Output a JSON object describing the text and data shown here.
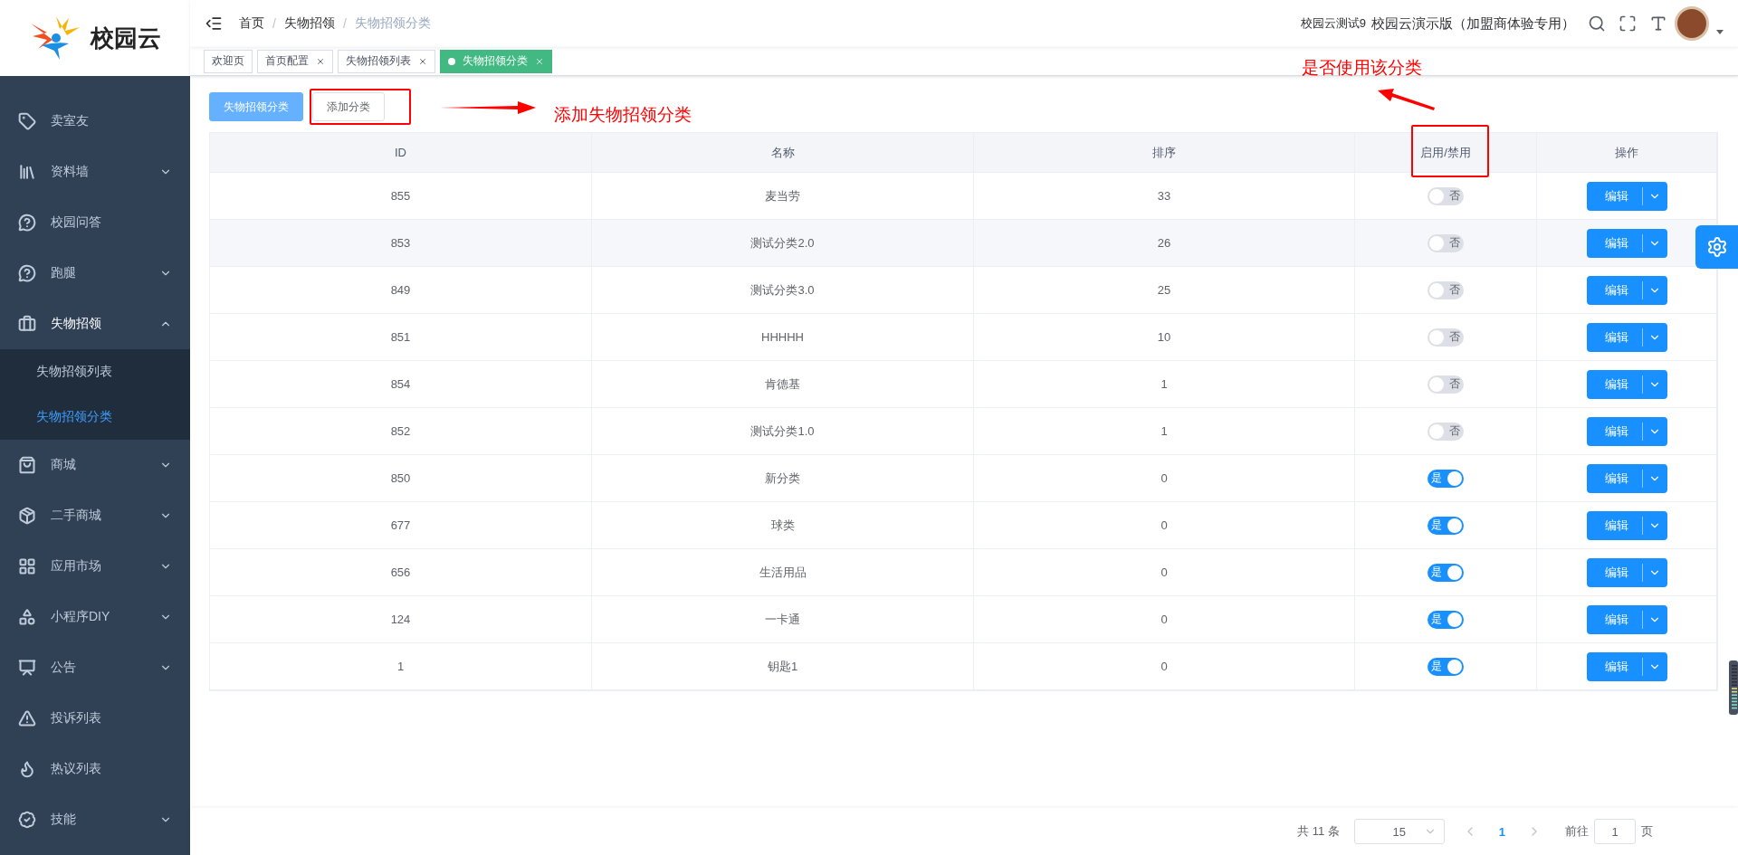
{
  "logo": {
    "text": "校园云"
  },
  "sidebar": {
    "items": [
      {
        "label": "卖室友",
        "expandable": false,
        "expanded": false
      },
      {
        "label": "资料墙",
        "expandable": true,
        "expanded": false
      },
      {
        "label": "校园问答",
        "expandable": false,
        "expanded": false
      },
      {
        "label": "跑腿",
        "expandable": true,
        "expanded": false
      },
      {
        "label": "失物招领",
        "expandable": true,
        "expanded": true,
        "children": [
          {
            "label": "失物招领列表",
            "selected": false
          },
          {
            "label": "失物招领分类",
            "selected": true
          }
        ]
      },
      {
        "label": "商城",
        "expandable": true,
        "expanded": false
      },
      {
        "label": "二手商城",
        "expandable": true,
        "expanded": false
      },
      {
        "label": "应用市场",
        "expandable": true,
        "expanded": false
      },
      {
        "label": "小程序DIY",
        "expandable": true,
        "expanded": false
      },
      {
        "label": "公告",
        "expandable": true,
        "expanded": false
      },
      {
        "label": "投诉列表",
        "expandable": false,
        "expanded": false
      },
      {
        "label": "热议列表",
        "expandable": false,
        "expanded": false
      },
      {
        "label": "技能",
        "expandable": true,
        "expanded": false
      }
    ]
  },
  "breadcrumb": {
    "separator": "/",
    "items": [
      "首页",
      "失物招领",
      "失物招领分类"
    ]
  },
  "header": {
    "account": "校园云测试9",
    "org": "校园云演示版（加盟商体验专用）"
  },
  "tags": [
    {
      "label": "欢迎页",
      "selected": false,
      "closable": false
    },
    {
      "label": "首页配置",
      "selected": false,
      "closable": true
    },
    {
      "label": "失物招领列表",
      "selected": false,
      "closable": true
    },
    {
      "label": "失物招领分类",
      "selected": true,
      "closable": true
    }
  ],
  "toolbar": [
    {
      "label": "失物招领分类",
      "selected": true
    },
    {
      "label": "添加分类",
      "selected": false
    }
  ],
  "annotations": [
    {
      "text": "添加失物招领分类"
    },
    {
      "text": "是否使用该分类"
    }
  ],
  "table": {
    "columns": [
      "ID",
      "名称",
      "排序",
      "启用/禁用",
      "操作"
    ],
    "rows": [
      {
        "id": "855",
        "name": "麦当劳",
        "sort": "33",
        "on": false,
        "switch_text": "否",
        "action": "编辑"
      },
      {
        "id": "853",
        "name": "测试分类2.0",
        "sort": "26",
        "on": false,
        "switch_text": "否",
        "action": "编辑"
      },
      {
        "id": "849",
        "name": "测试分类3.0",
        "sort": "25",
        "on": false,
        "switch_text": "否",
        "action": "编辑"
      },
      {
        "id": "851",
        "name": "HHHHH",
        "sort": "10",
        "on": false,
        "switch_text": "否",
        "action": "编辑"
      },
      {
        "id": "854",
        "name": "肯德基",
        "sort": "1",
        "on": false,
        "switch_text": "否",
        "action": "编辑"
      },
      {
        "id": "852",
        "name": "测试分类1.0",
        "sort": "1",
        "on": false,
        "switch_text": "否",
        "action": "编辑"
      },
      {
        "id": "850",
        "name": "新分类",
        "sort": "0",
        "on": true,
        "switch_text": "是",
        "action": "编辑"
      },
      {
        "id": "677",
        "name": "球类",
        "sort": "0",
        "on": true,
        "switch_text": "是",
        "action": "编辑"
      },
      {
        "id": "656",
        "name": "生活用品",
        "sort": "0",
        "on": true,
        "switch_text": "是",
        "action": "编辑"
      },
      {
        "id": "124",
        "name": "一卡通",
        "sort": "0",
        "on": true,
        "switch_text": "是",
        "action": "编辑"
      },
      {
        "id": "1",
        "name": "钥匙1",
        "sort": "0",
        "on": true,
        "switch_text": "是",
        "action": "编辑"
      }
    ]
  },
  "pagination": {
    "total": "共 11 条",
    "page_size": "15",
    "current_page": "1",
    "goto_label": "前往",
    "goto_value": "1",
    "goto_suffix": "页"
  }
}
